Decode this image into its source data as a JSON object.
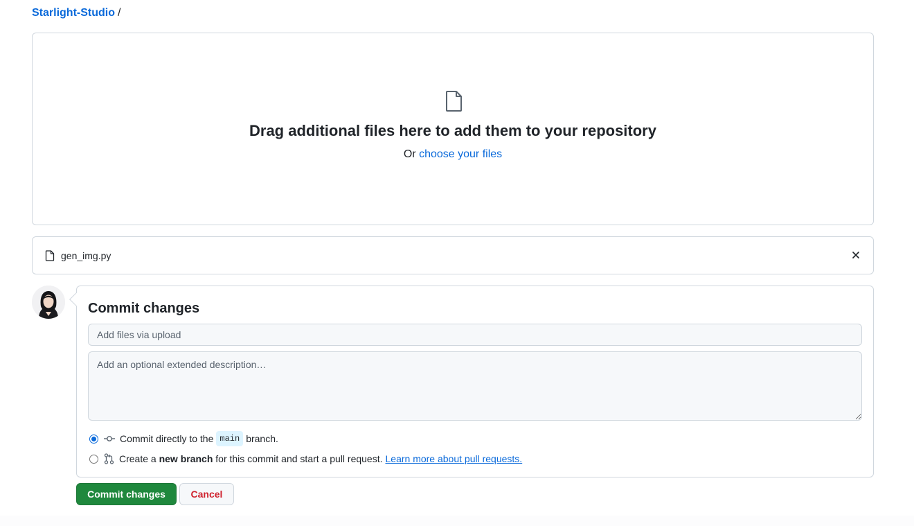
{
  "breadcrumb": {
    "owner": "Starlight-Studio",
    "separator": "/"
  },
  "dropzone": {
    "icon": "file-icon",
    "headline": "Drag additional files here to add them to your repository",
    "or_text": "Or",
    "choose_link": "choose your files"
  },
  "file": {
    "icon": "file-icon",
    "name": "gen_img.py",
    "remove_icon": "close-icon"
  },
  "commit": {
    "title": "Commit changes",
    "summary_placeholder": "Add files via upload",
    "description_placeholder": "Add an optional extended description…",
    "option_direct": {
      "selected": true,
      "icon": "git-commit-icon",
      "prefix": "Commit directly to the",
      "branch": "main",
      "suffix": "branch."
    },
    "option_branch": {
      "selected": false,
      "icon": "git-pull-request-icon",
      "prefix": "Create a",
      "bold": "new branch",
      "suffix": "for this commit and start a pull request.",
      "link": "Learn more about pull requests."
    }
  },
  "buttons": {
    "commit": "Commit changes",
    "cancel": "Cancel"
  },
  "colors": {
    "link": "#0969da",
    "primary": "#1f883d",
    "danger": "#cf222e",
    "border": "#d0d7de"
  }
}
